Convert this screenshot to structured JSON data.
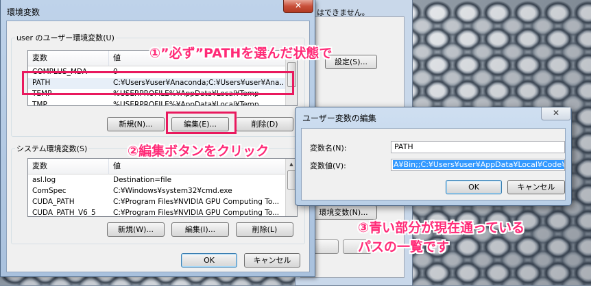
{
  "main_dialog": {
    "title": "環境変数",
    "close_glyph": "✕",
    "user_section": {
      "label": "user のユーザー環境変数(U)",
      "header_var": "変数",
      "header_val": "値",
      "rows": [
        {
          "name": "COMPLUS_MDA",
          "value": "0"
        },
        {
          "name": "PATH",
          "value": "C:¥Users¥user¥Anaconda;C:¥Users¥user¥Ana..."
        },
        {
          "name": "TEMP",
          "value": "%USERPROFILE%¥AppData¥Local¥Temp"
        },
        {
          "name": "TMP",
          "value": "%USERPROFILE%¥AppData¥Local¥Temp"
        }
      ],
      "new_button": "新規(N)...",
      "edit_button": "編集(E)...",
      "delete_button": "削除(D)"
    },
    "system_section": {
      "label": "システム環境変数(S)",
      "header_var": "変数",
      "header_val": "値",
      "rows": [
        {
          "name": "asl.log",
          "value": "Destination=file"
        },
        {
          "name": "ComSpec",
          "value": "C:¥Windows¥system32¥cmd.exe"
        },
        {
          "name": "CUDA_PATH",
          "value": "C:¥Program Files¥NVIDIA GPU Computing To..."
        },
        {
          "name": "CUDA_PATH_V6_5",
          "value": "C:¥Program Files¥NVIDIA GPU Computing To..."
        }
      ],
      "new_button": "新規(W)...",
      "edit_button": "編集(I)...",
      "delete_button": "削除(L)"
    },
    "ok_button": "OK",
    "cancel_button": "キャンセル"
  },
  "behind_window": {
    "text": "はできません。",
    "settings_button": "設定(S)...",
    "env_button": "環境変数(N)..."
  },
  "edit_dialog": {
    "title": "ユーザー変数の編集",
    "close_glyph": "✕",
    "name_label": "変数名(N):",
    "name_value": "PATH",
    "value_label": "変数値(V):",
    "value_value": "A¥Bin;;C:¥Users¥user¥AppData¥Local¥Code¥bin",
    "ok_button": "OK",
    "cancel_button": "キャンセル"
  },
  "annotations": {
    "step1": "①”必ず”PATHを選んだ状態で",
    "step2": "②編集ボタンをクリック",
    "step3_line1": "③青い部分が現在通っている",
    "step3_line2": "パスの一覧です"
  },
  "colors": {
    "annotation_pink": "#ff2a77",
    "highlight_border": "#e9195e",
    "selection_blue": "#3399ff"
  }
}
